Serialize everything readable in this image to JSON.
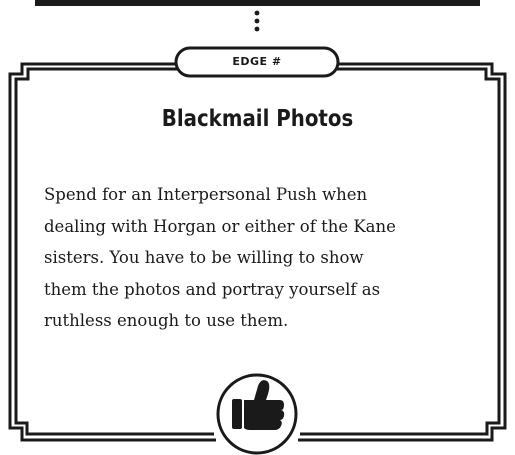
{
  "card": {
    "edge_label": "EDGE #",
    "title": "Blackmail Photos",
    "body_lines": [
      "Spend for an Interpersonal Push when",
      "dealing with Horgan or either of the Kane",
      "sisters. You have to be willing to show",
      "them the photos and portray yourself as",
      "ruthless enough to use them."
    ],
    "icon": "thumbs-up-icon"
  },
  "colors": {
    "ink": "#1a1a1a",
    "background": "#ffffff"
  }
}
